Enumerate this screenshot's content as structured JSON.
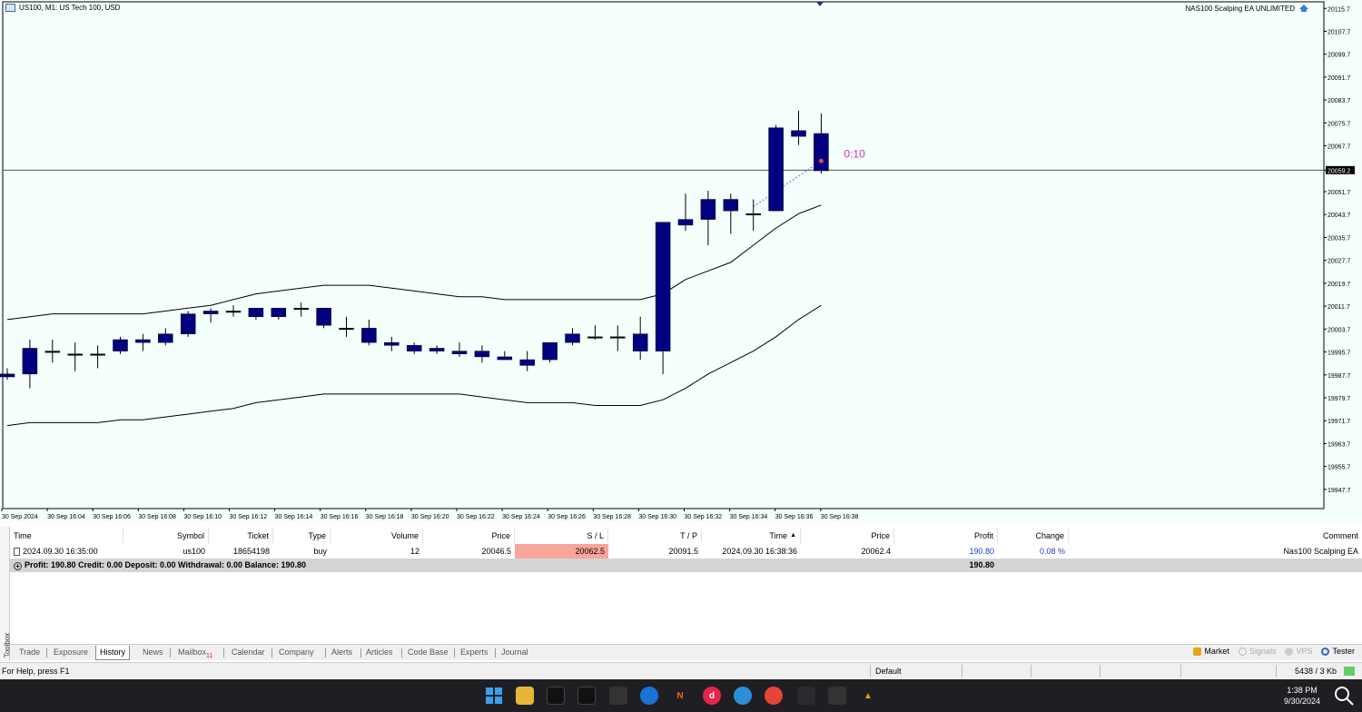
{
  "chart": {
    "title": "US100, M1:  US Tech 100, USD",
    "ea_name": "NAS100 Scalping EA UNLIMITED",
    "countdown": "0:10",
    "price_tag": "20059.2",
    "price_ticks": [
      "20115.7",
      "20107.7",
      "20099.7",
      "20091.7",
      "20083.7",
      "20075.7",
      "20067.7",
      "20059.2",
      "20051.7",
      "20043.7",
      "20035.7",
      "20027.7",
      "20019.7",
      "20011.7",
      "20003.7",
      "19995.7",
      "19987.7",
      "19979.7",
      "19971.7",
      "19963.7",
      "19955.7",
      "19947.7"
    ],
    "time_ticks": [
      "30 Sep 2024",
      "30 Sep 16:04",
      "30 Sep 16:06",
      "30 Sep 16:08",
      "30 Sep 16:10",
      "30 Sep 16:12",
      "30 Sep 16:14",
      "30 Sep 16:16",
      "30 Sep 16:18",
      "30 Sep 16:20",
      "30 Sep 16:22",
      "30 Sep 16:24",
      "30 Sep 16:26",
      "30 Sep 16:28",
      "30 Sep 16:30",
      "30 Sep 16:32",
      "30 Sep 16:34",
      "30 Sep 16:36",
      "30 Sep 16:38"
    ]
  },
  "chart_data": {
    "type": "candlestick",
    "symbol": "US100",
    "timeframe": "M1",
    "ylim": [
      19941,
      20118
    ],
    "candles": [
      {
        "o": 19988,
        "h": 19990,
        "l": 19986,
        "c": 19987
      },
      {
        "o": 19988,
        "h": 20000,
        "l": 19983,
        "c": 19997
      },
      {
        "o": 19996,
        "h": 20000,
        "l": 19992,
        "c": 19996
      },
      {
        "o": 19995,
        "h": 19999,
        "l": 19989,
        "c": 19995
      },
      {
        "o": 19995,
        "h": 19998,
        "l": 19990,
        "c": 19995
      },
      {
        "o": 19996,
        "h": 20001,
        "l": 19995,
        "c": 20000
      },
      {
        "o": 19999,
        "h": 20002,
        "l": 19996,
        "c": 20000
      },
      {
        "o": 19999,
        "h": 20004,
        "l": 19998,
        "c": 20002
      },
      {
        "o": 20002,
        "h": 20010,
        "l": 20001,
        "c": 20009
      },
      {
        "o": 20009,
        "h": 20011,
        "l": 20006,
        "c": 20010
      },
      {
        "o": 20010,
        "h": 20012,
        "l": 20008,
        "c": 20010
      },
      {
        "o": 20008,
        "h": 20011,
        "l": 20007,
        "c": 20011
      },
      {
        "o": 20008,
        "h": 20011,
        "l": 20007,
        "c": 20011
      },
      {
        "o": 20011,
        "h": 20013,
        "l": 20008,
        "c": 20011
      },
      {
        "o": 20005,
        "h": 20011,
        "l": 20004,
        "c": 20011
      },
      {
        "o": 20004,
        "h": 20008,
        "l": 20001,
        "c": 20004
      },
      {
        "o": 19999,
        "h": 20007,
        "l": 19998,
        "c": 20004
      },
      {
        "o": 19998,
        "h": 20001,
        "l": 19996,
        "c": 19999
      },
      {
        "o": 19998,
        "h": 19999,
        "l": 19995,
        "c": 19996
      },
      {
        "o": 19996,
        "h": 19998,
        "l": 19995,
        "c": 19997
      },
      {
        "o": 19995,
        "h": 19999,
        "l": 19994,
        "c": 19996
      },
      {
        "o": 19994,
        "h": 19998,
        "l": 19992,
        "c": 19996
      },
      {
        "o": 19993,
        "h": 19996,
        "l": 19993,
        "c": 19994
      },
      {
        "o": 19991,
        "h": 19996,
        "l": 19989,
        "c": 19993
      },
      {
        "o": 19993,
        "h": 19999,
        "l": 19992,
        "c": 19999
      },
      {
        "o": 19999,
        "h": 20004,
        "l": 19998,
        "c": 20002
      },
      {
        "o": 20001,
        "h": 20005,
        "l": 20000,
        "c": 20001
      },
      {
        "o": 20001,
        "h": 20005,
        "l": 19996,
        "c": 20001
      },
      {
        "o": 19996,
        "h": 20008,
        "l": 19993,
        "c": 20002
      },
      {
        "o": 19996,
        "h": 20041,
        "l": 19988,
        "c": 20041
      },
      {
        "o": 20040,
        "h": 20051,
        "l": 20038,
        "c": 20042
      },
      {
        "o": 20042,
        "h": 20052,
        "l": 20033,
        "c": 20049
      },
      {
        "o": 20045,
        "h": 20051,
        "l": 20037,
        "c": 20049
      },
      {
        "o": 20044,
        "h": 20049,
        "l": 20038,
        "c": 20044
      },
      {
        "o": 20045,
        "h": 20075,
        "l": 20045,
        "c": 20074
      },
      {
        "o": 20073,
        "h": 20080,
        "l": 20068,
        "c": 20071
      },
      {
        "o": 20059,
        "h": 20079,
        "l": 20058,
        "c": 20072
      }
    ],
    "bollinger_upper": [
      20007,
      20008,
      20009,
      20009,
      20009,
      20009,
      20009,
      20010,
      20011,
      20012,
      20014,
      20016,
      20017,
      20018,
      20019,
      20019,
      20019,
      20018,
      20017,
      20016,
      20015,
      20015,
      20014,
      20014,
      20014,
      20014,
      20014,
      20014,
      20014,
      20016,
      20021,
      20024,
      20027,
      20033,
      20039,
      20044,
      20047
    ],
    "bollinger_lower": [
      19970,
      19971,
      19971,
      19971,
      19971,
      19972,
      19972,
      19973,
      19974,
      19975,
      19976,
      19978,
      19979,
      19980,
      19981,
      19981,
      19981,
      19981,
      19981,
      19981,
      19981,
      19980,
      19979,
      19978,
      19978,
      19978,
      19977,
      19977,
      19977,
      19979,
      19983,
      19988,
      19992,
      19996,
      20001,
      20007,
      20012
    ],
    "current_price": 20059.2,
    "trade_arrow": {
      "from_index": 33,
      "from": 20046.5,
      "to_index": 36,
      "to": 20062.4
    }
  },
  "table": {
    "headers": [
      "Time",
      "Symbol",
      "Ticket",
      "Type",
      "Volume",
      "Price",
      "S / L",
      "T / P",
      "Time",
      "Price",
      "Profit",
      "Change",
      "Comment"
    ],
    "rows": [
      {
        "time": "2024.09.30 16:35:00",
        "symbol": "us100",
        "ticket": "18654198",
        "type": "buy",
        "volume": "12",
        "price": "20046.5",
        "sl": "20062.5",
        "tp": "20091.5",
        "close_time": "2024.09.30 16:38:36",
        "close_price": "20062.4",
        "profit": "190.80",
        "change": "0.08 %",
        "comment": "Nas100 Scalping EA"
      }
    ],
    "summary": "Profit: 190.80  Credit: 0.00  Deposit: 0.00  Withdrawal: 0.00  Balance: 190.80",
    "summary_total": "190.80"
  },
  "toolbox_label": "Toolbox",
  "tabs": [
    {
      "label": "Trade"
    },
    {
      "label": "Exposure"
    },
    {
      "label": "History",
      "active": true
    },
    {
      "label": "News"
    },
    {
      "label": "Mailbox",
      "badge": "11"
    },
    {
      "label": "Calendar"
    },
    {
      "label": "Company"
    },
    {
      "label": "Alerts"
    },
    {
      "label": "Articles"
    },
    {
      "label": "Code Base"
    },
    {
      "label": "Experts"
    },
    {
      "label": "Journal"
    }
  ],
  "right_tabs": {
    "market": "Market",
    "signals": "Signals",
    "vps": "VPS",
    "tester": "Tester"
  },
  "status": {
    "help": "For Help, press F1",
    "profile": "Default",
    "traffic": "5438 / 3 Kb"
  },
  "clock": {
    "time": "1:38 PM",
    "date": "9/30/2024"
  },
  "colors": {
    "candle": "#000080",
    "chart_bg": "#f5fffc",
    "sl_bg": "#f9a59c",
    "countdown": "#cc33cc"
  }
}
